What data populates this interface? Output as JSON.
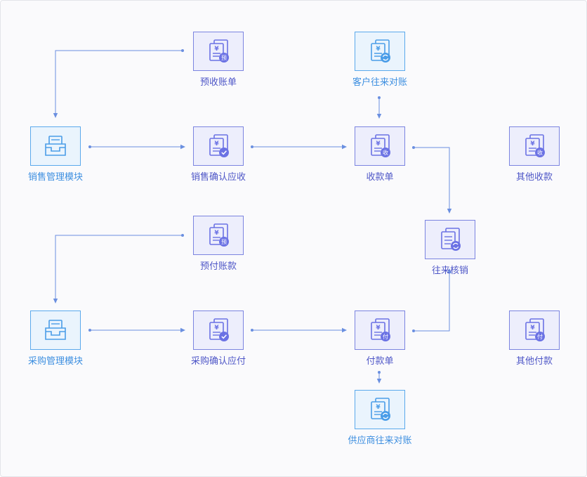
{
  "colors": {
    "doc_accent": "#6b72e4",
    "module_accent": "#4a9de8",
    "arrow": "#6a8fe0"
  },
  "nodes": {
    "prepay_receipt": {
      "label": "预收账单",
      "badge": "预",
      "icon": "document-yen-icon"
    },
    "customer_recon": {
      "label": "客户往来对账",
      "badge": "",
      "icon": "document-yen-icon"
    },
    "sales_module": {
      "label": "销售管理模块",
      "icon": "inbox-tray-icon"
    },
    "sales_confirm": {
      "label": "销售确认应收",
      "badge": "",
      "icon": "document-yen-icon"
    },
    "receipt": {
      "label": "收款单",
      "badge": "收",
      "icon": "document-yen-icon"
    },
    "other_receipt": {
      "label": "其他收款",
      "badge": "收",
      "icon": "document-yen-icon"
    },
    "prepay_payment": {
      "label": "预付账款",
      "badge": "预",
      "icon": "document-yen-icon"
    },
    "writeoff": {
      "label": "往来核销",
      "badge": "",
      "icon": "document-icon"
    },
    "purchase_module": {
      "label": "采购管理模块",
      "icon": "inbox-tray-icon"
    },
    "purchase_confirm": {
      "label": "采购确认应付",
      "badge": "",
      "icon": "document-yen-icon"
    },
    "payment": {
      "label": "付款单",
      "badge": "付",
      "icon": "document-yen-icon"
    },
    "other_payment": {
      "label": "其他付款",
      "badge": "付",
      "icon": "document-yen-icon"
    },
    "supplier_recon": {
      "label": "供应商往来对账",
      "badge": "",
      "icon": "document-yen-icon"
    }
  }
}
